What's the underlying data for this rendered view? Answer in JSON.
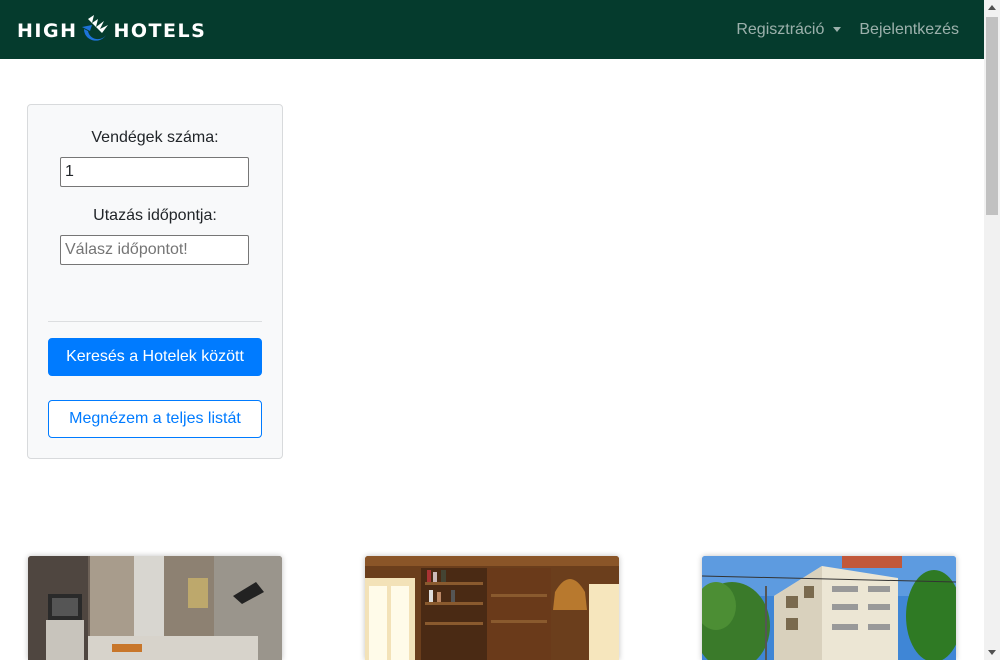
{
  "navbar": {
    "brand_left": "HIGH",
    "brand_right": "HOTELS",
    "logo_icon": "high-hotels-logo-icon",
    "links": [
      {
        "label": "Regisztráció",
        "has_dropdown": true
      },
      {
        "label": "Bejelentkezés",
        "has_dropdown": false
      }
    ],
    "background_color": "#053b2d"
  },
  "search": {
    "guests_label": "Vendégek száma:",
    "guests_value": "1",
    "date_label": "Utazás időpontja:",
    "date_placeholder": "Válasz időpontot!",
    "search_button": "Keresés a Hotelek között",
    "list_button": "Megnézem a teljes listát",
    "accent_color": "#007bff"
  },
  "hotels": [
    {
      "image": "hotel-room-photo"
    },
    {
      "image": "hotel-library-room-photo"
    },
    {
      "image": "hotel-building-exterior-photo"
    }
  ]
}
